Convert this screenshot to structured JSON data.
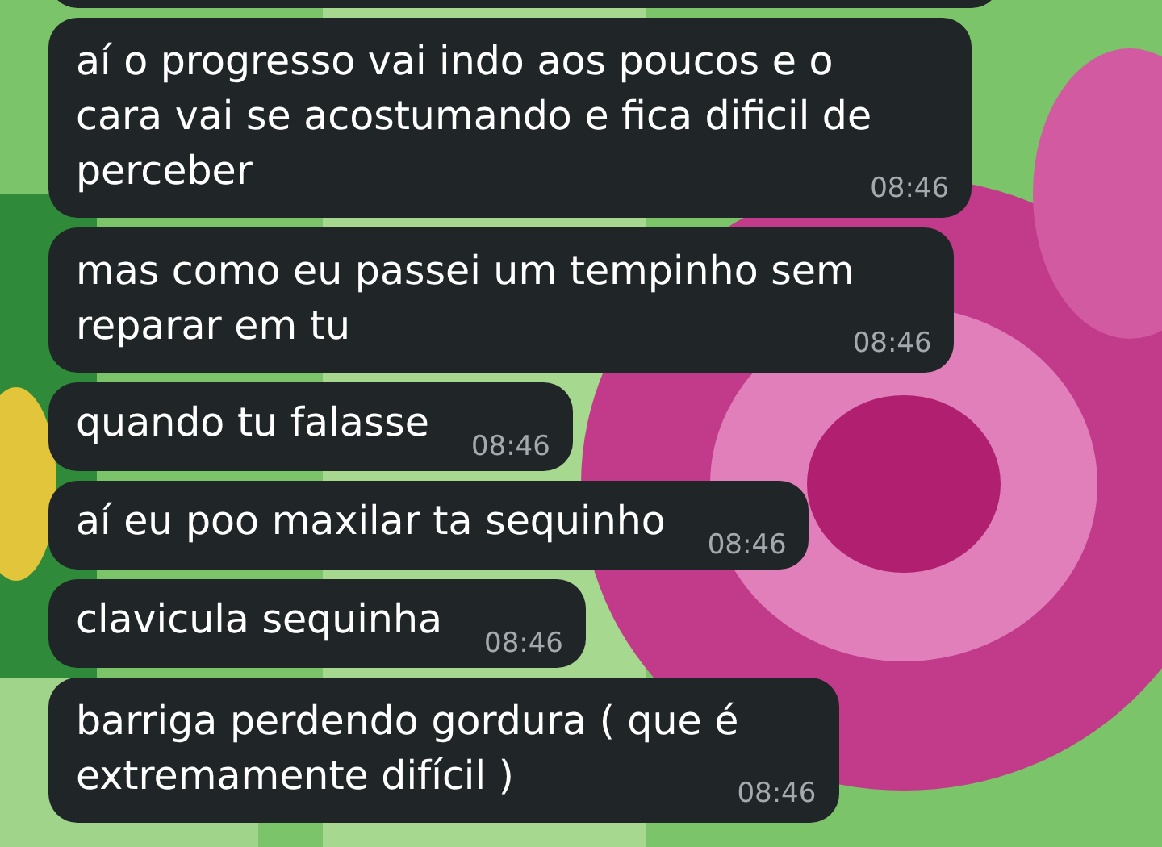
{
  "messages": [
    {
      "kind": "partial"
    },
    {
      "kind": "text",
      "lines": [
        "aí o progresso vai indo aos poucos e o",
        "cara vai se acostumando e fica dificil de",
        "perceber"
      ],
      "time": "08:46"
    },
    {
      "kind": "text",
      "lines": [
        "mas como eu passei um tempinho sem",
        "reparar em tu"
      ],
      "time": "08:46"
    },
    {
      "kind": "text",
      "lines": [
        "quando tu falasse"
      ],
      "time": "08:46"
    },
    {
      "kind": "text",
      "lines": [
        "aí eu poo maxilar ta sequinho"
      ],
      "time": "08:46"
    },
    {
      "kind": "text",
      "lines": [
        "clavicula sequinha"
      ],
      "time": "08:46"
    },
    {
      "kind": "text",
      "lines": [
        "barriga perdendo gordura ( que é",
        "extremamente difícil )"
      ],
      "time": "08:46"
    }
  ]
}
